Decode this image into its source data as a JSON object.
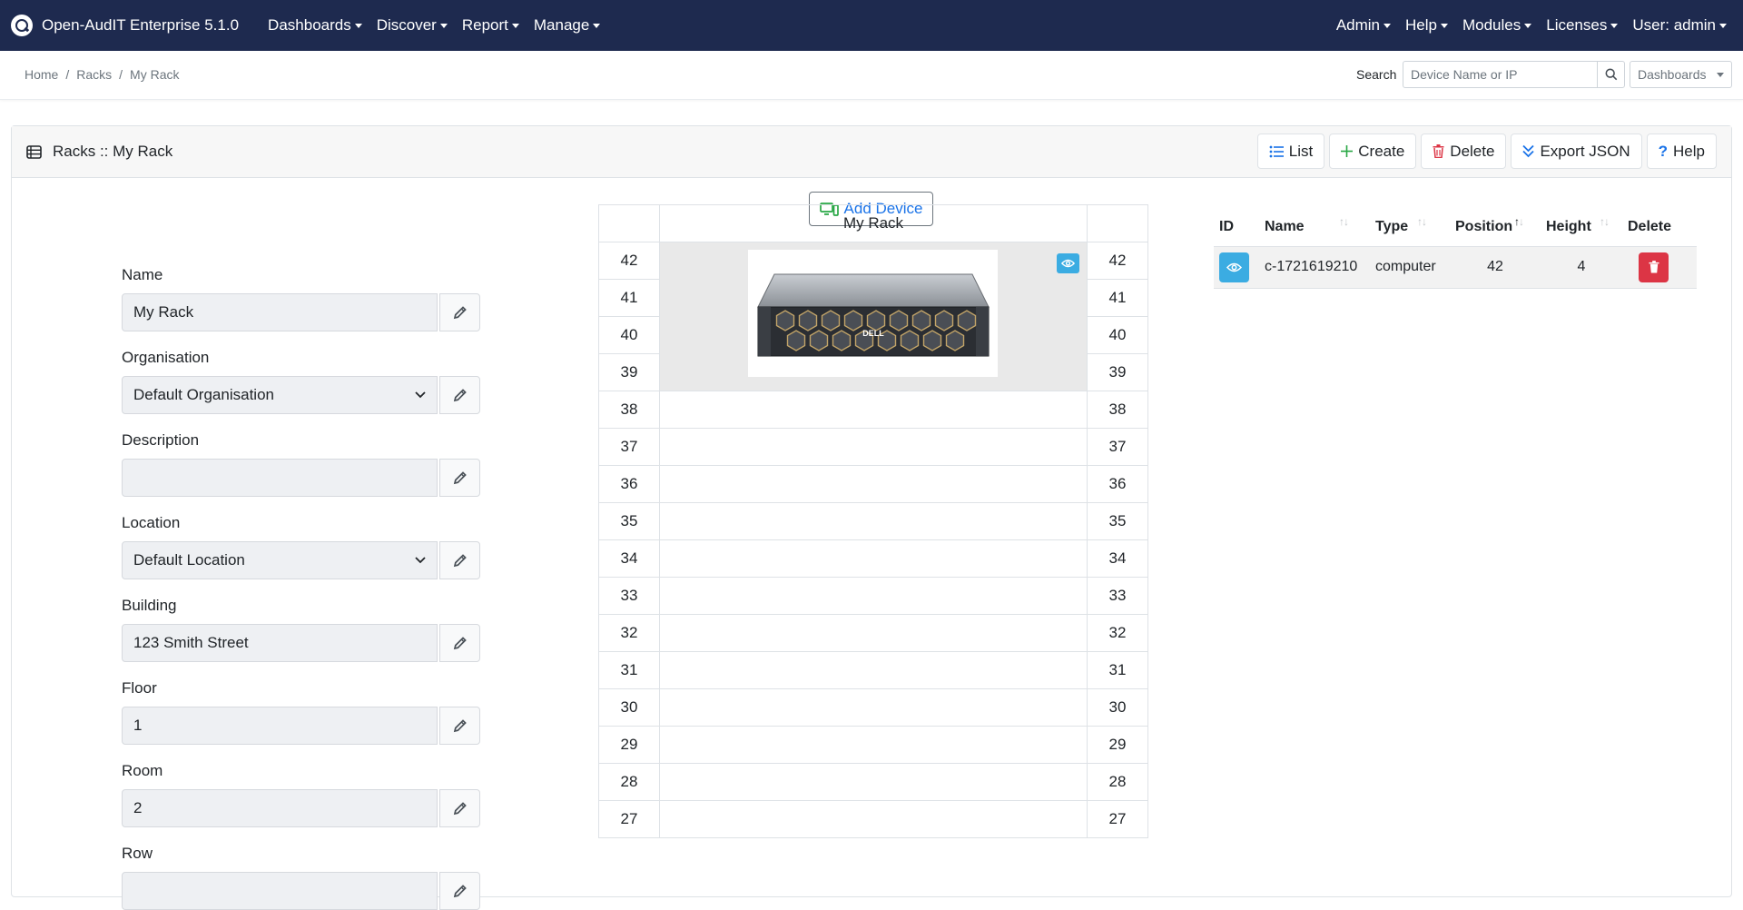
{
  "app": {
    "title": "Open-AudIT Enterprise 5.1.0",
    "nav_left": [
      "Dashboards",
      "Discover",
      "Report",
      "Manage"
    ],
    "nav_right": [
      "Admin",
      "Help",
      "Modules",
      "Licenses",
      "User: admin"
    ]
  },
  "breadcrumb": [
    "Home",
    "Racks",
    "My Rack"
  ],
  "search": {
    "label": "Search",
    "placeholder": "Device Name or IP",
    "dashboards_label": "Dashboards"
  },
  "card": {
    "title": "Racks :: My Rack",
    "buttons": {
      "list": "List",
      "create": "Create",
      "delete": "Delete",
      "export": "Export JSON",
      "help": "Help"
    },
    "add_device": "Add Device"
  },
  "form": {
    "name_label": "Name",
    "name_value": "My Rack",
    "org_label": "Organisation",
    "org_value": "Default Organisation",
    "description_label": "Description",
    "description_value": "",
    "location_label": "Location",
    "location_value": "Default Location",
    "building_label": "Building",
    "building_value": "123 Smith Street",
    "floor_label": "Floor",
    "floor_value": "1",
    "room_label": "Room",
    "room_value": "2",
    "row_label": "Row"
  },
  "rack": {
    "title": "My Rack",
    "units": [
      42,
      41,
      40,
      39,
      38,
      37,
      36,
      35,
      34,
      33,
      32,
      31,
      30,
      29,
      28,
      27
    ],
    "device_top_unit": 42,
    "device_height": 4,
    "server_brand": "DELL"
  },
  "devices_table": {
    "headers": [
      "ID",
      "Name",
      "Type",
      "Position",
      "Height",
      "Delete"
    ],
    "rows": [
      {
        "name": "c-1721619210",
        "type": "computer",
        "position": "42",
        "height": "4"
      }
    ]
  },
  "colors": {
    "navbar": "#1e2a4f",
    "info": "#3bace2",
    "danger": "#dc3545",
    "success": "#28a745",
    "primary": "#1a73e8"
  },
  "icons": [
    "search-icon",
    "rack-icon",
    "list-icon",
    "plus-icon",
    "trash-icon",
    "double-chevron-down-icon",
    "question-icon",
    "monitor-add-icon",
    "pencil-icon",
    "chevron-down-icon",
    "eye-icon"
  ]
}
